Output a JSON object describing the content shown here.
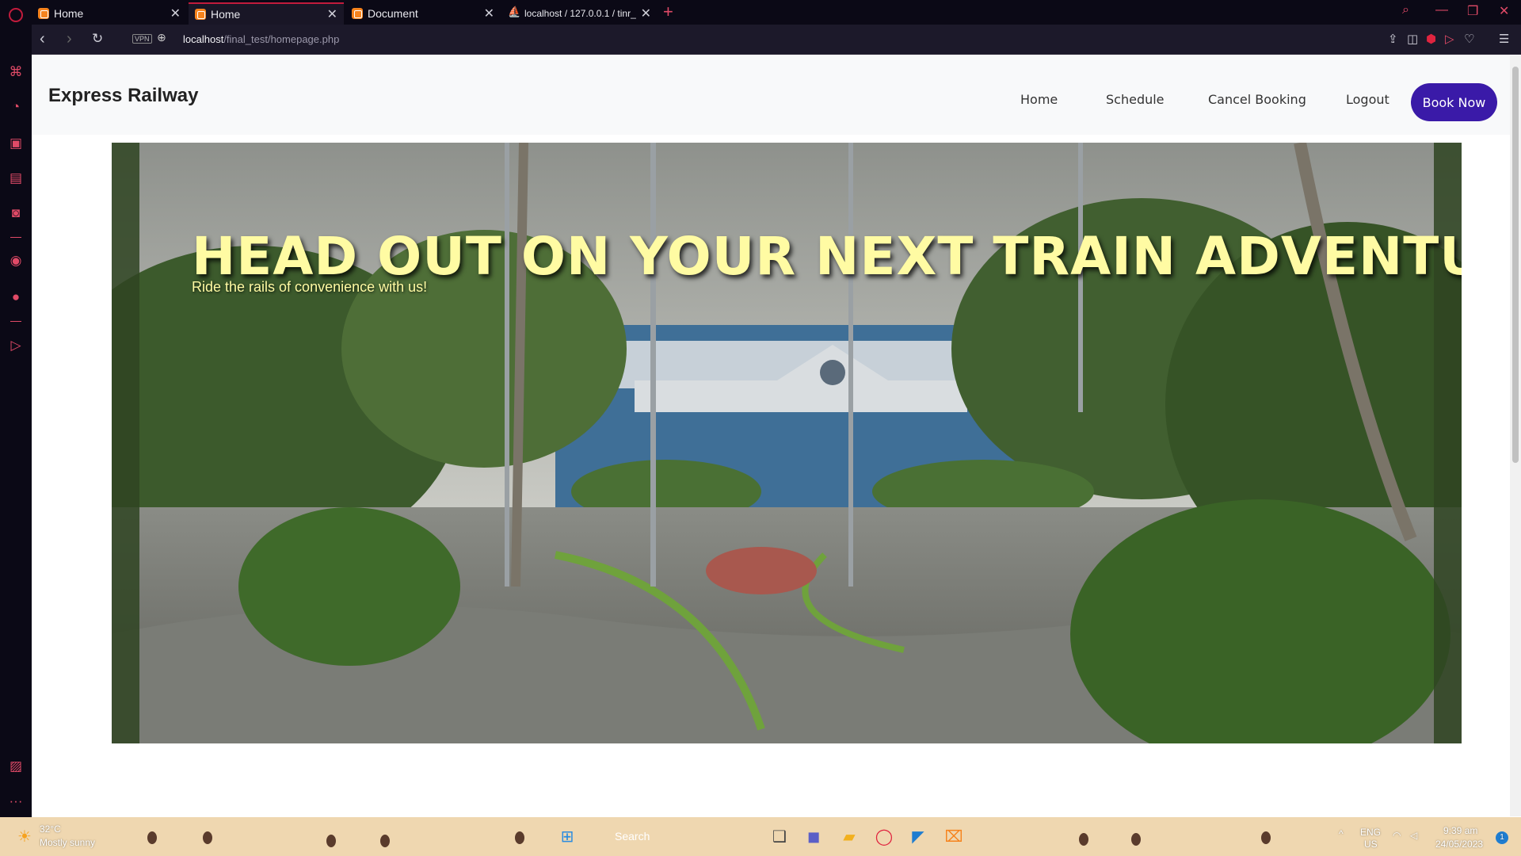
{
  "browser": {
    "tabs": [
      {
        "title": "Home",
        "active": false
      },
      {
        "title": "Home",
        "active": true
      },
      {
        "title": "Document",
        "active": false
      },
      {
        "title": "localhost / 127.0.0.1 / tinr_",
        "active": false
      }
    ],
    "vpn_badge": "VPN",
    "url_host": "localhost",
    "url_path": "/final_test/homepage.php"
  },
  "site": {
    "brand": "Express Railway",
    "nav": [
      {
        "label": "Home"
      },
      {
        "label": "Schedule"
      },
      {
        "label": "Cancel Booking"
      },
      {
        "label": "Logout"
      }
    ],
    "cta_label": "Book Now",
    "accent_color": "#3a1aa8"
  },
  "hero": {
    "title": "HEAD OUT ON YOUR NEXT TRAIN ADVENTURE",
    "subtitle": "Ride the rails of convenience with us!",
    "title_color": "#fffba3"
  },
  "taskbar": {
    "weather_temp": "32°C",
    "weather_desc": "Mostly sunny",
    "search_label": "Search",
    "lang_top": "ENG",
    "lang_bottom": "US",
    "time": "9:39 am",
    "date": "24/05/2023",
    "notification_count": "1"
  }
}
